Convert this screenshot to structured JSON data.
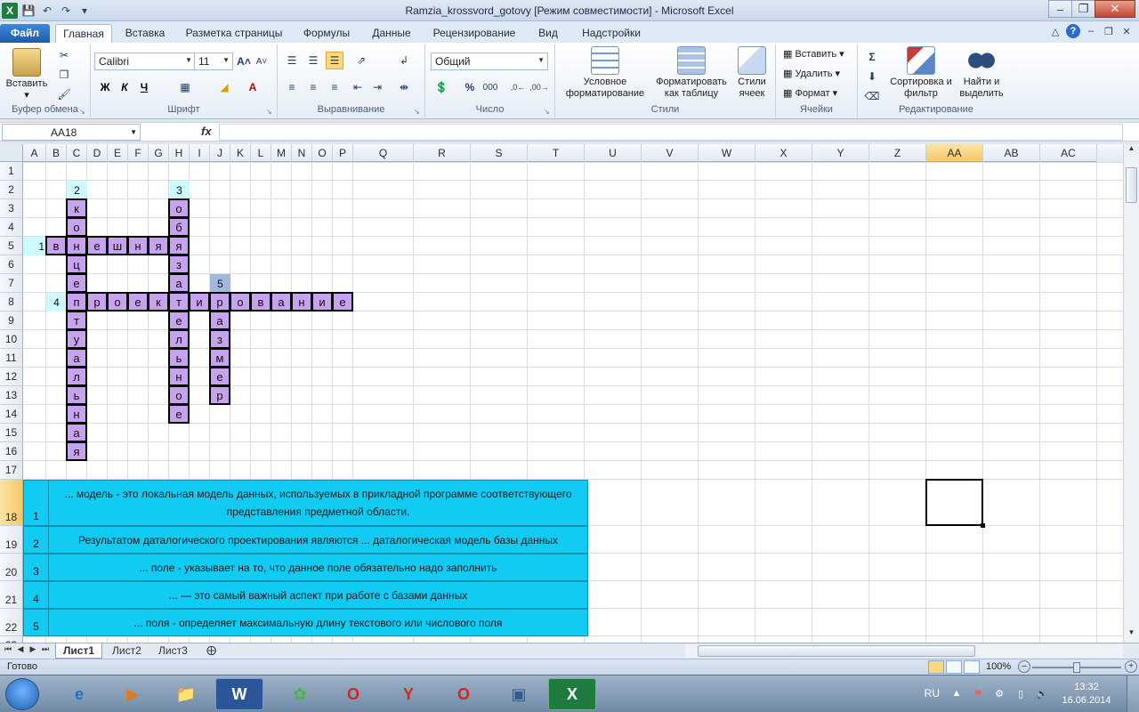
{
  "window": {
    "title": "Ramzia_krossvord_gotovy  [Режим совместимости]  -  Microsoft Excel",
    "app_icon": "X"
  },
  "tabs": [
    {
      "label": "Файл"
    },
    {
      "label": "Главная"
    },
    {
      "label": "Вставка"
    },
    {
      "label": "Разметка страницы"
    },
    {
      "label": "Формулы"
    },
    {
      "label": "Данные"
    },
    {
      "label": "Рецензирование"
    },
    {
      "label": "Вид"
    },
    {
      "label": "Надстройки"
    }
  ],
  "active_tab": "Главная",
  "ribbon": {
    "clipboard": {
      "label": "Буфер обмена",
      "paste": "Вставить"
    },
    "font": {
      "label": "Шрифт",
      "font_name": "Calibri",
      "font_size": "11",
      "bold": "Ж",
      "italic": "К",
      "underline": "Ч"
    },
    "alignment": {
      "label": "Выравнивание"
    },
    "number": {
      "label": "Число",
      "format": "Общий",
      "percent": "%",
      "thousands": "000"
    },
    "styles": {
      "label": "Стили",
      "conditional": "Условное форматирование",
      "as_table": "Форматировать как таблицу",
      "cell_styles": "Стили ячеек"
    },
    "cells": {
      "label": "Ячейки",
      "insert": "Вставить",
      "delete": "Удалить",
      "format": "Формат"
    },
    "editing": {
      "label": "Редактирование",
      "sort": "Сортировка и фильтр",
      "find": "Найти и выделить",
      "sigma": "Σ"
    }
  },
  "formula_bar": {
    "name_box": "AA18",
    "fx": "fx",
    "value": ""
  },
  "columns": [
    "A",
    "B",
    "C",
    "D",
    "E",
    "F",
    "G",
    "H",
    "I",
    "J",
    "K",
    "L",
    "M",
    "N",
    "O",
    "P",
    "Q",
    "R",
    "S",
    "T",
    "U",
    "V",
    "W",
    "X",
    "Y",
    "Z",
    "AA",
    "AB",
    "AC"
  ],
  "rows": [
    "1",
    "2",
    "3",
    "4",
    "5",
    "6",
    "7",
    "8",
    "9",
    "10",
    "11",
    "12",
    "13",
    "14",
    "15",
    "16",
    "17",
    "18",
    "19",
    "20",
    "21",
    "22",
    "23"
  ],
  "crossword": {
    "numbers": [
      {
        "n": "1",
        "col": 0,
        "row": 4
      },
      {
        "n": "2",
        "col": 2,
        "row": 1
      },
      {
        "n": "3",
        "col": 7,
        "row": 1
      },
      {
        "n": "4",
        "col": 1,
        "row": 7
      },
      {
        "n": "5",
        "col": 9,
        "row": 6
      }
    ],
    "words": [
      {
        "dir": "across",
        "col": 1,
        "row": 4,
        "letters": [
          "в",
          "н",
          "е",
          "ш",
          "н",
          "я",
          "я"
        ]
      },
      {
        "dir": "down",
        "col": 2,
        "row": 2,
        "letters": [
          "к",
          "о",
          "н",
          "ц",
          "е",
          "п",
          "т",
          "у",
          "а",
          "л",
          "ь",
          "н",
          "а",
          "я"
        ]
      },
      {
        "dir": "down",
        "col": 7,
        "row": 2,
        "letters": [
          "о",
          "б",
          "я",
          "з",
          "а",
          "т",
          "е",
          "л",
          "ь",
          "н",
          "о",
          "е"
        ]
      },
      {
        "dir": "across",
        "col": 2,
        "row": 7,
        "letters": [
          "п",
          "р",
          "о",
          "е",
          "к",
          "т",
          "и",
          "р",
          "о",
          "в",
          "а",
          "н",
          "и",
          "е"
        ]
      },
      {
        "dir": "down",
        "col": 9,
        "row": 8,
        "letters": [
          "а",
          "з",
          "м",
          "е",
          "р"
        ]
      }
    ]
  },
  "clues": [
    {
      "n": "1",
      "text": "... модель - это локальная модель данных, используемых в прикладной программе соответствующего представления предметной области."
    },
    {
      "n": "2",
      "text": "Результатом даталогического проектирования являются ... даталогическая модель базы данных"
    },
    {
      "n": "3",
      "text": "... поле - указывает на то, что данное поле обязательно надо заполнить"
    },
    {
      "n": "4",
      "text": "... — это самый важный аспект при работе с базами данных"
    },
    {
      "n": "5",
      "text": "... поля - определяет максимальную длину текстового или числового поля"
    }
  ],
  "sheets": [
    {
      "label": "Лист1"
    },
    {
      "label": "Лист2"
    },
    {
      "label": "Лист3"
    }
  ],
  "status": {
    "ready": "Готово",
    "zoom": "100%"
  },
  "taskbar": {
    "apps": [
      "W",
      "X"
    ],
    "lang": "RU",
    "time": "13:32",
    "date": "16.06.2014"
  }
}
